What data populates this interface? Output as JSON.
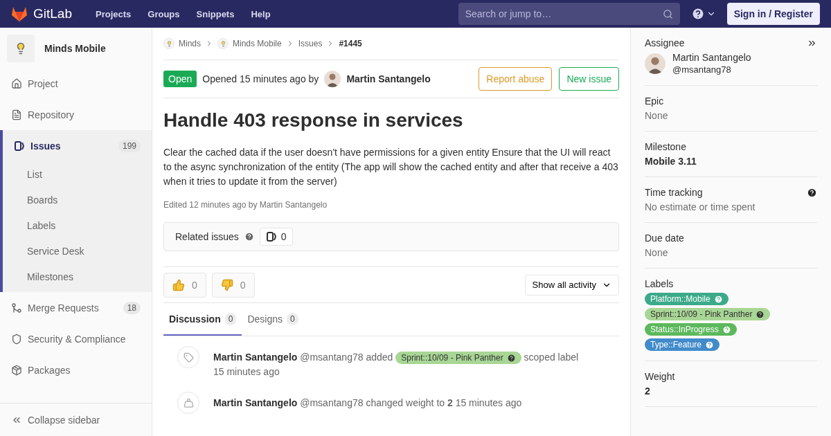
{
  "header": {
    "logo": "GitLab",
    "nav": [
      "Projects",
      "Groups",
      "Snippets",
      "Help"
    ],
    "search": {
      "placeholder": "Search or jump to…"
    },
    "sign_in": "Sign in / Register"
  },
  "sidebar": {
    "project": "Minds Mobile",
    "items": [
      {
        "label": "Project",
        "selected": false
      },
      {
        "label": "Repository",
        "selected": false
      },
      {
        "label": "Issues",
        "count": "199",
        "selected": true,
        "children": [
          {
            "label": "List"
          },
          {
            "label": "Boards"
          },
          {
            "label": "Labels"
          },
          {
            "label": "Service Desk"
          },
          {
            "label": "Milestones"
          }
        ]
      },
      {
        "label": "Merge Requests",
        "count": "18",
        "selected": false
      },
      {
        "label": "Security & Compliance",
        "selected": false
      },
      {
        "label": "Packages",
        "selected": false
      }
    ],
    "collapse": "Collapse sidebar"
  },
  "breadcrumbs": [
    {
      "label": "Minds",
      "avatar": true
    },
    {
      "label": "Minds Mobile",
      "avatar": true
    },
    {
      "label": "Issues",
      "avatar": false
    },
    {
      "label": "#1445",
      "avatar": false
    }
  ],
  "issue": {
    "status": "Open",
    "opened": "Opened 15 minutes ago by",
    "author": "Martin Santangelo",
    "buttons": [
      {
        "label": "Report abuse",
        "color": "#db9a26"
      },
      {
        "label": "New issue",
        "color": "#1aaa55"
      }
    ],
    "title": "Handle 403 response in services",
    "description": "Clear the cached data if the user doesn't have permissions for a given entity Ensure that the UI will react to the async synchronization of the entity (The app will show the cached entity and after that receive a 403 when it tries to update it from the server)",
    "edited": "Edited 12 minutes ago by Martin Santangelo"
  },
  "related": {
    "label": "Related issues",
    "count": "0"
  },
  "awards": [
    {
      "kind": "up",
      "count": "0"
    },
    {
      "kind": "down",
      "count": "0"
    }
  ],
  "filter": "Show all activity",
  "tabs": [
    {
      "label": "Discussion",
      "count": "0",
      "selected": true
    },
    {
      "label": "Designs",
      "count": "0",
      "selected": false
    }
  ],
  "activity": [
    {
      "kind": "label",
      "author": "Martin Santangelo",
      "handle": "@msantang78",
      "action": "added",
      "label": {
        "text": "Sprint::10/09 - Pink Panther",
        "color": "#a8d695"
      },
      "suffix": "scoped label",
      "time": "15 minutes ago"
    },
    {
      "kind": "weight",
      "author": "Martin Santangelo",
      "handle": "@msantang78",
      "text": "changed weight to **2** 15 minutes ago"
    }
  ],
  "right": {
    "assignee": {
      "title": "Assignee",
      "name": "Martin Santangelo",
      "handle": "@msantang78"
    },
    "sections": [
      {
        "title": "Epic",
        "value": "None",
        "kind": "muted"
      },
      {
        "title": "Milestone",
        "value": "Mobile 3.11",
        "kind": "bold"
      },
      {
        "title": "Time tracking",
        "value": "No estimate or time spent",
        "kind": "muted",
        "help": true
      },
      {
        "title": "Due date",
        "value": "None",
        "kind": "muted"
      }
    ],
    "labels": {
      "title": "Labels",
      "items": [
        {
          "text": "Platform::Mobile",
          "color": "#3caa8a"
        },
        {
          "text": "Sprint::10/09 - Pink Panther",
          "color": "#a8d695"
        },
        {
          "text": "Status::InProgress",
          "color": "#5cb85c"
        },
        {
          "text": "Type::Feature",
          "color": "#428bca"
        }
      ]
    },
    "weight": {
      "title": "Weight",
      "value": "2"
    }
  }
}
